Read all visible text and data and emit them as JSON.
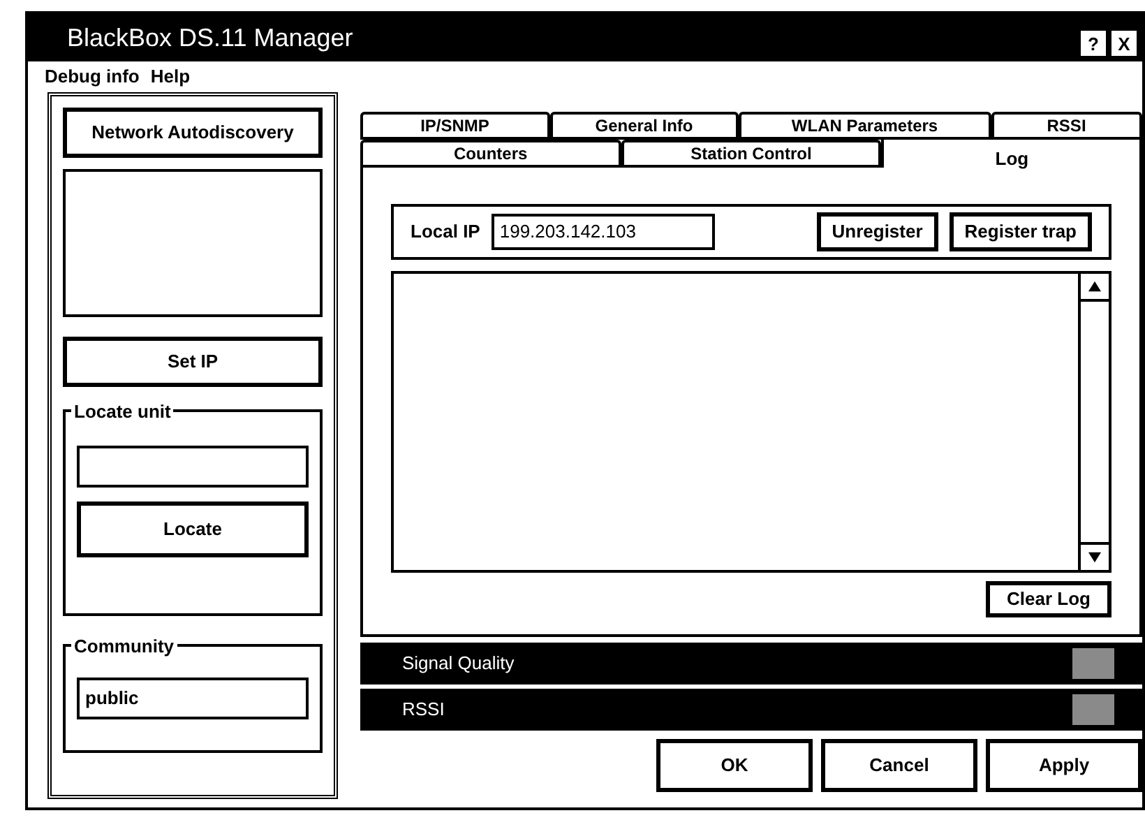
{
  "window": {
    "title": "BlackBox DS.11 Manager",
    "title_buttons": [
      "?",
      "X"
    ]
  },
  "menu": [
    "Debug info",
    "Help"
  ],
  "sidebar": {
    "discover_button": "Network Autodiscovery",
    "set_ip_button": "Set IP",
    "locate_group": {
      "label": "Locate unit",
      "button": "Locate"
    },
    "community_group": {
      "label": "Community",
      "value": "public"
    }
  },
  "tab_rows": [
    [
      {
        "label": "IP/SNMP",
        "selected": false
      },
      {
        "label": "General Info",
        "selected": false
      },
      {
        "label": "WLAN Parameters",
        "selected": false
      },
      {
        "label": "RSSI",
        "selected": false
      }
    ],
    [
      {
        "label": "Counters",
        "selected": false
      },
      {
        "label": "Station Control",
        "selected": false
      },
      {
        "label": "Log",
        "selected": true
      }
    ]
  ],
  "log_tab": {
    "local_ip_label": "Local IP",
    "local_ip": "199.203.142.103",
    "buttons": [
      "Unregister",
      "Register trap"
    ],
    "clear_button": "Clear Log"
  },
  "status_bars": [
    {
      "label": "Signal Quality"
    },
    {
      "label": "RSSI"
    }
  ],
  "buttons": [
    "OK",
    "Cancel",
    "Apply"
  ]
}
